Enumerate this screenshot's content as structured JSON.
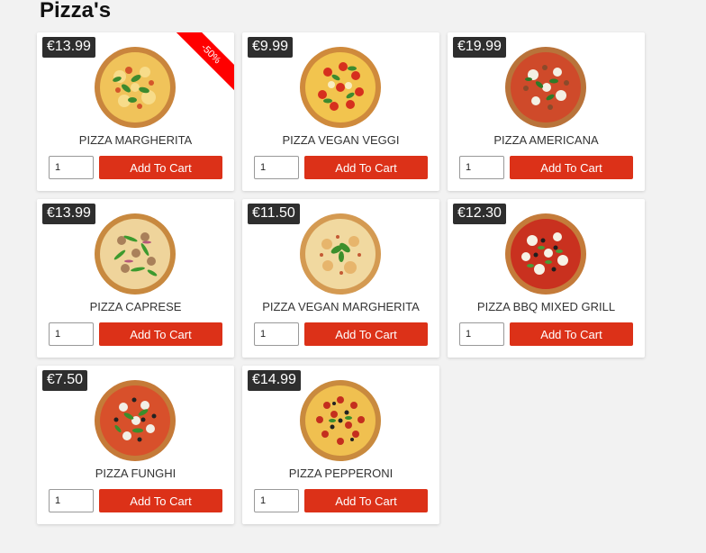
{
  "page": {
    "title": "Pizza's"
  },
  "colors": {
    "button": "#dc3118",
    "price_badge": "#2e2e2e",
    "ribbon": "#ff0000",
    "background": "#f2f2f2"
  },
  "products": [
    {
      "price": "€13.99",
      "name": "PIZZA MARGHERITA",
      "qty": "1",
      "button_label": "Add To Cart",
      "badge": "-50%",
      "image": "pizza-margherita-image"
    },
    {
      "price": "€9.99",
      "name": "PIZZA VEGAN VEGGI",
      "qty": "1",
      "button_label": "Add To Cart",
      "image": "pizza-vegan-veggi-image"
    },
    {
      "price": "€19.99",
      "name": "PIZZA AMERICANA",
      "qty": "1",
      "button_label": "Add To Cart",
      "image": "pizza-americana-image"
    },
    {
      "price": "€13.99",
      "name": "PIZZA CAPRESE",
      "qty": "1",
      "button_label": "Add To Cart",
      "image": "pizza-caprese-image"
    },
    {
      "price": "€11.50",
      "name": "PIZZA VEGAN MARGHERITA",
      "qty": "1",
      "button_label": "Add To Cart",
      "image": "pizza-vegan-margherita-image"
    },
    {
      "price": "€12.30",
      "name": "PIZZA BBQ MIXED GRILL",
      "qty": "1",
      "button_label": "Add To Cart",
      "image": "pizza-bbq-mixed-grill-image"
    },
    {
      "price": "€7.50",
      "name": "PIZZA FUNGHI",
      "qty": "1",
      "button_label": "Add To Cart",
      "image": "pizza-funghi-image"
    },
    {
      "price": "€14.99",
      "name": "PIZZA PEPPERONI",
      "qty": "1",
      "button_label": "Add To Cart",
      "image": "pizza-pepperoni-image"
    }
  ]
}
